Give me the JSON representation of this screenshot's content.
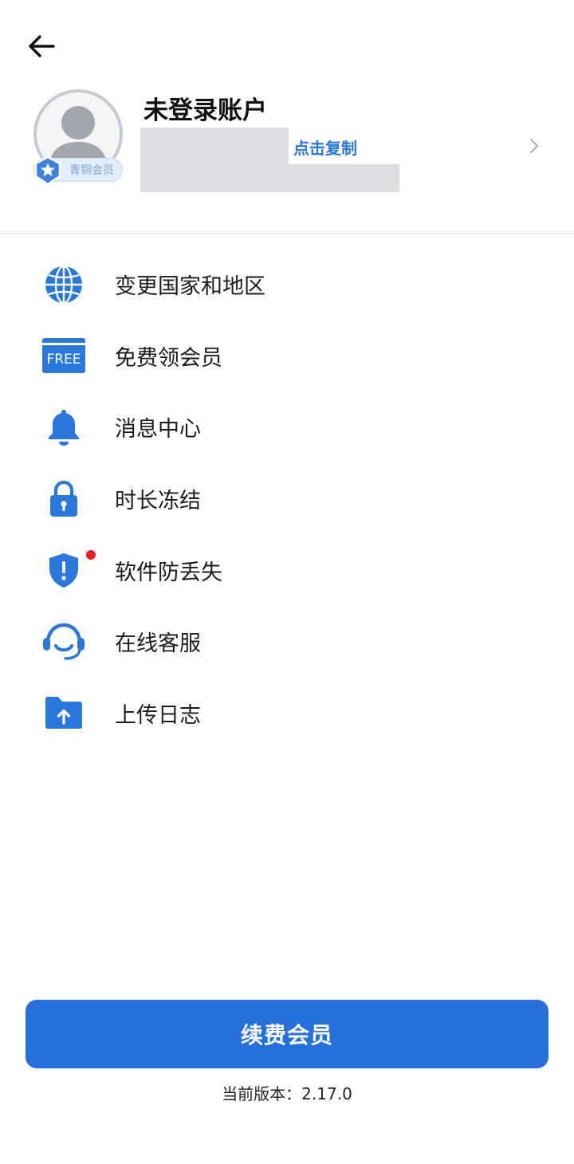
{
  "header": {
    "account_title": "未登录账户",
    "copy_label": "点击复制",
    "badge_label": "青铜会员"
  },
  "menu": [
    {
      "id": "country",
      "label": "变更国家和地区",
      "icon": "globe-icon"
    },
    {
      "id": "free",
      "label": "免费领会员",
      "icon": "free-icon",
      "icon_text": "FREE"
    },
    {
      "id": "messages",
      "label": "消息中心",
      "icon": "bell-icon"
    },
    {
      "id": "freeze",
      "label": "时长冻结",
      "icon": "lock-icon"
    },
    {
      "id": "anti-loss",
      "label": "软件防丢失",
      "icon": "shield-alert-icon",
      "has_dot": true
    },
    {
      "id": "support",
      "label": "在线客服",
      "icon": "headset-icon"
    },
    {
      "id": "upload-log",
      "label": "上传日志",
      "icon": "folder-upload-icon"
    }
  ],
  "footer": {
    "renew_label": "续费会员",
    "version_text": "当前版本：2.17.0"
  },
  "colors": {
    "accent": "#2670db",
    "link": "#2878dc",
    "dot": "#ee1c25"
  }
}
